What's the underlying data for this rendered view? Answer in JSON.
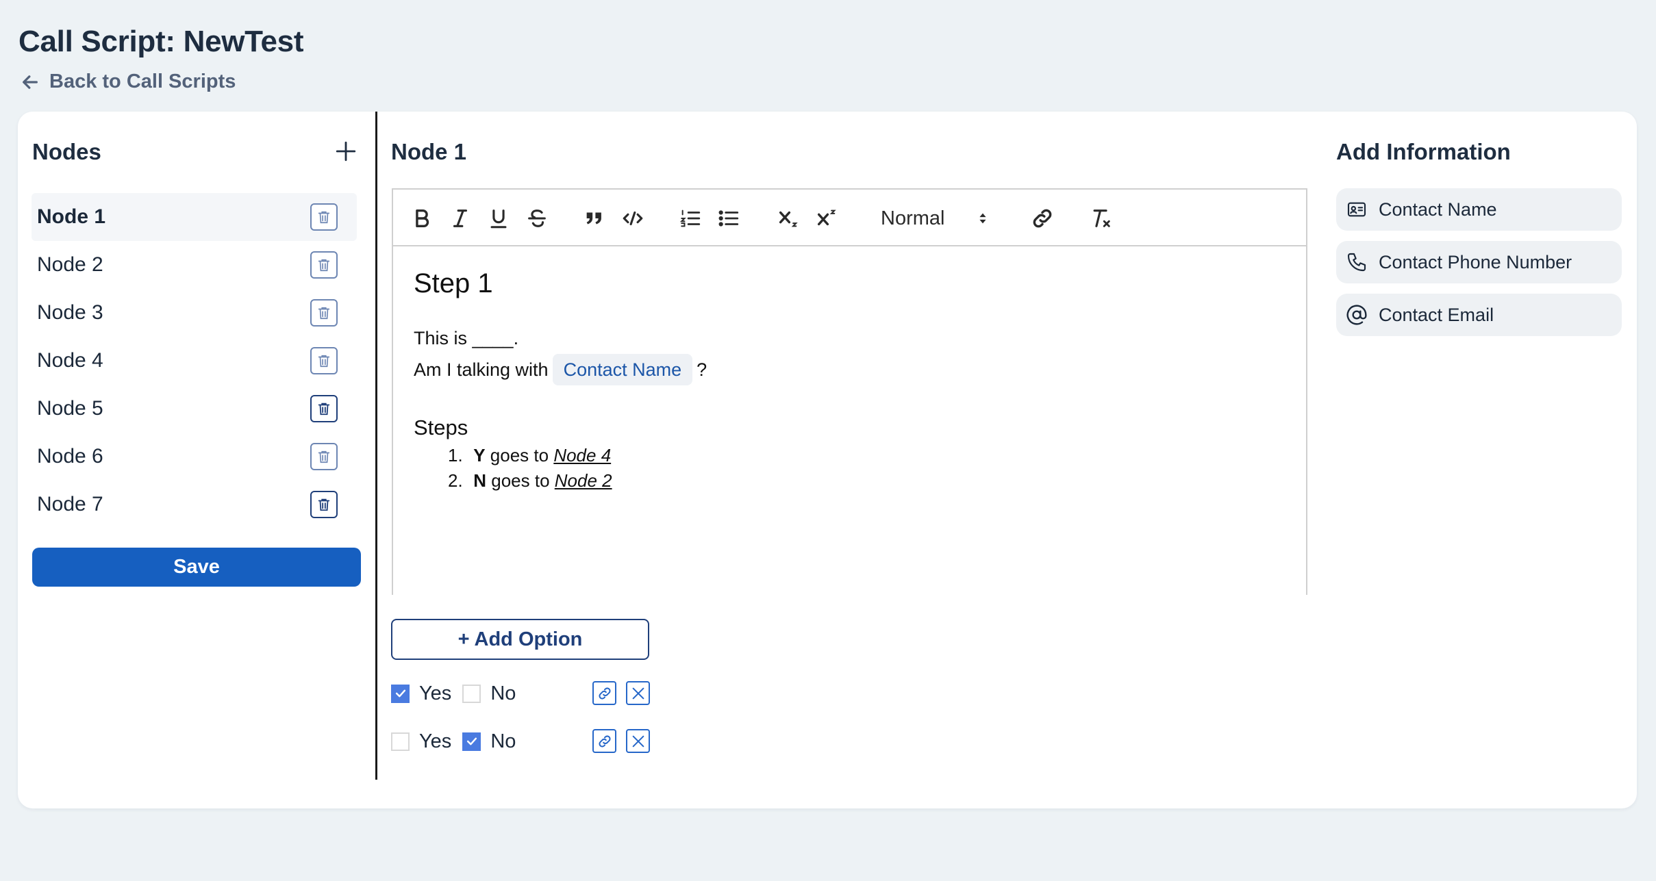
{
  "header": {
    "title": "Call Script: NewTest",
    "back_label": "Back to Call Scripts"
  },
  "nodes_panel": {
    "title": "Nodes",
    "items": [
      {
        "label": "Node 1",
        "active": true
      },
      {
        "label": "Node 2"
      },
      {
        "label": "Node 3"
      },
      {
        "label": "Node 4"
      },
      {
        "label": "Node 5"
      },
      {
        "label": "Node 6"
      },
      {
        "label": "Node 7"
      }
    ],
    "save_label": "Save"
  },
  "editor": {
    "title": "Node 1",
    "toolbar": {
      "header_select": "Normal",
      "tools": [
        "bold-icon",
        "italic-icon",
        "underline-icon",
        "strike-icon",
        "blockquote-icon",
        "code-block-icon",
        "ordered-list-icon",
        "bullet-list-icon",
        "subscript-icon",
        "superscript-icon",
        "link-icon",
        "clear-format-icon"
      ]
    },
    "content": {
      "heading": "Step 1",
      "line1": "This is ____.",
      "line2_pre": "Am I talking with",
      "line2_chip": "Contact Name",
      "line2_post": "?",
      "steps_title": "Steps",
      "steps": [
        {
          "num": "1.",
          "key": "Y",
          "mid": " goes to ",
          "target": "Node 4"
        },
        {
          "num": "2.",
          "key": "N",
          "mid": " goes to ",
          "target": "Node 2"
        }
      ]
    },
    "add_option_label": "+ Add Option",
    "options": [
      {
        "yes_label": "Yes",
        "no_label": "No",
        "yes": true,
        "no": false
      },
      {
        "yes_label": "Yes",
        "no_label": "No",
        "yes": false,
        "no": true
      }
    ]
  },
  "info_panel": {
    "title": "Add Information",
    "items": [
      {
        "label": "Contact Name",
        "icon": "contact-card-icon"
      },
      {
        "label": "Contact Phone Number",
        "icon": "phone-icon"
      },
      {
        "label": "Contact Email",
        "icon": "at-sign-icon"
      }
    ]
  },
  "colors": {
    "background": "#edf2f5",
    "primary": "#165fc0",
    "checkbox_on": "#4a7be0",
    "chip_text": "#1c56a8"
  }
}
